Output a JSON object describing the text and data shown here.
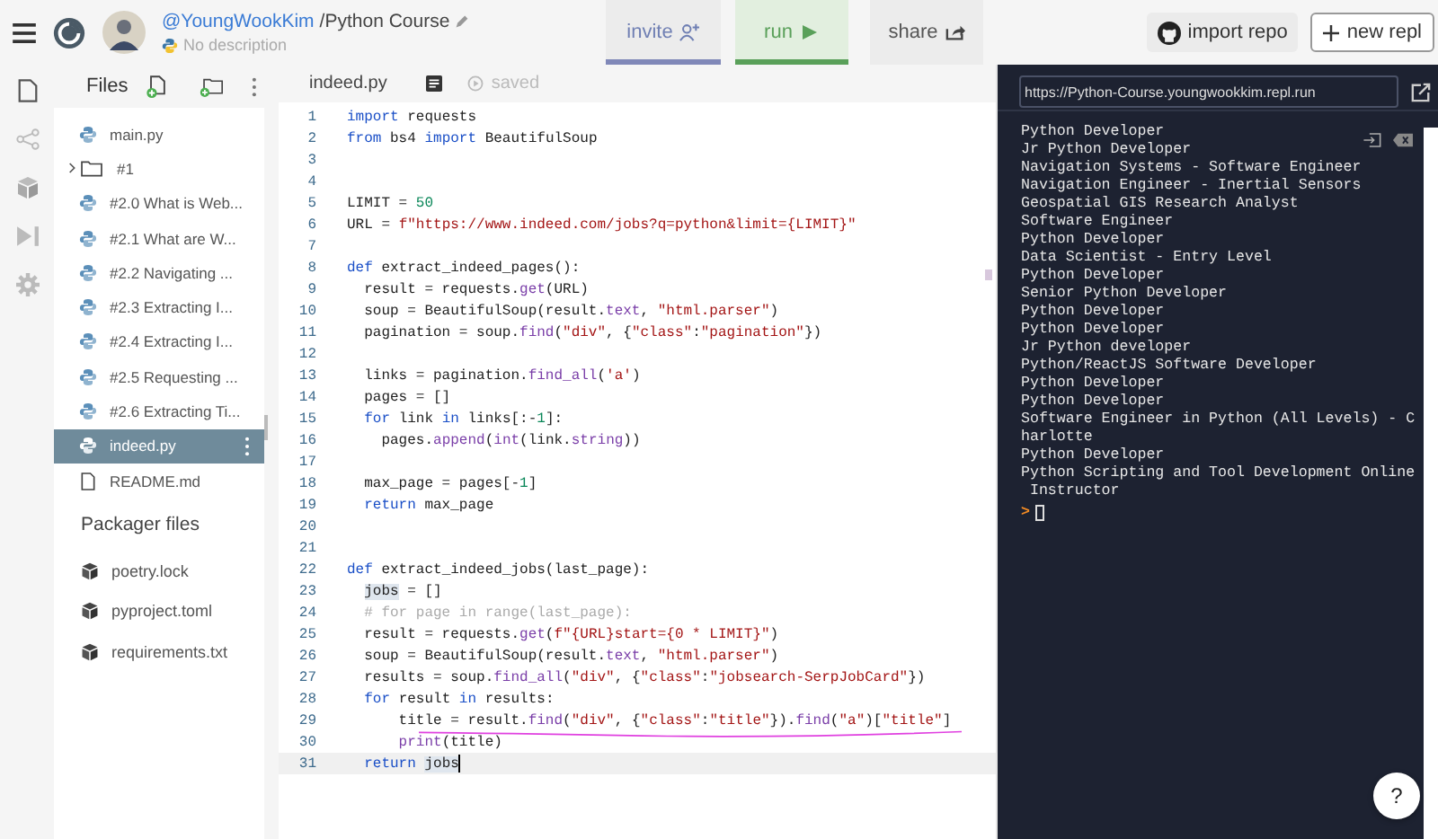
{
  "header": {
    "user": "@YoungWookKim",
    "project": "/Python Course",
    "description": "No description",
    "actions": [
      {
        "kind": "invite",
        "label": "invite",
        "selected": true
      },
      {
        "kind": "run",
        "label": "run",
        "selected": true
      },
      {
        "kind": "share",
        "label": "share",
        "selected": false
      }
    ],
    "import_label": "import repo",
    "new_label": "new repl"
  },
  "rail": [
    {
      "kind": "files",
      "selected": true
    },
    {
      "kind": "share",
      "selected": false
    },
    {
      "kind": "packages",
      "selected": false
    },
    {
      "kind": "debugger",
      "selected": false
    },
    {
      "kind": "settings",
      "selected": false
    }
  ],
  "files": {
    "title": "Files",
    "items": [
      {
        "kind": "python",
        "name": "main.py",
        "selected": false
      },
      {
        "kind": "folder",
        "name": "#1",
        "selected": false,
        "expanded": false
      },
      {
        "kind": "python",
        "name": "#2.0 What is Web...",
        "selected": false
      },
      {
        "kind": "python",
        "name": "#2.1 What are W...",
        "selected": false
      },
      {
        "kind": "python",
        "name": "#2.2 Navigating ...",
        "selected": false
      },
      {
        "kind": "python",
        "name": "#2.3 Extracting I...",
        "selected": false
      },
      {
        "kind": "python",
        "name": "#2.4 Extracting I...",
        "selected": false
      },
      {
        "kind": "python",
        "name": "#2.5 Requesting ...",
        "selected": false
      },
      {
        "kind": "python",
        "name": "#2.6 Extracting Ti...",
        "selected": false
      },
      {
        "kind": "python",
        "name": "indeed.py",
        "selected": true
      },
      {
        "kind": "file",
        "name": "README.md",
        "selected": false
      }
    ],
    "packager_title": "Packager files",
    "packager_items": [
      "poetry.lock",
      "pyproject.toml",
      "requirements.txt"
    ]
  },
  "editor": {
    "tab": "indeed.py",
    "status": "saved",
    "lines": [
      {
        "n": "1",
        "tokens": [
          {
            "kind": "k",
            "text": "import"
          },
          {
            "kind": "p",
            "text": " requests"
          }
        ]
      },
      {
        "n": "2",
        "tokens": [
          {
            "kind": "k",
            "text": "from"
          },
          {
            "kind": "p",
            "text": " bs4 "
          },
          {
            "kind": "k",
            "text": "import"
          },
          {
            "kind": "p",
            "text": " BeautifulSoup"
          }
        ]
      },
      {
        "n": "3"
      },
      {
        "n": "4"
      },
      {
        "n": "5",
        "tokens": [
          {
            "kind": "p",
            "text": "LIMIT = "
          },
          {
            "kind": "n",
            "text": "50"
          }
        ]
      },
      {
        "n": "6",
        "tokens": [
          {
            "kind": "p",
            "text": "URL = "
          },
          {
            "kind": "s",
            "text": "f\"https://www.indeed.com/jobs?q=python&limit={LIMIT}\""
          }
        ]
      },
      {
        "n": "7"
      },
      {
        "n": "8",
        "tokens": [
          {
            "kind": "k",
            "text": "def"
          },
          {
            "kind": "p",
            "text": " extract_indeed_pages():"
          }
        ]
      },
      {
        "n": "9",
        "tokens": [
          {
            "kind": "p",
            "text": "  result = requests."
          },
          {
            "kind": "f",
            "text": "get"
          },
          {
            "kind": "p",
            "text": "(URL)"
          }
        ]
      },
      {
        "n": "10",
        "tokens": [
          {
            "kind": "p",
            "text": "  soup = BeautifulSoup(result."
          },
          {
            "kind": "f",
            "text": "text"
          },
          {
            "kind": "p",
            "text": ", "
          },
          {
            "kind": "s",
            "text": "\"html.parser\""
          },
          {
            "kind": "p",
            "text": ")"
          }
        ]
      },
      {
        "n": "11",
        "tokens": [
          {
            "kind": "p",
            "text": "  pagination = soup."
          },
          {
            "kind": "f",
            "text": "find"
          },
          {
            "kind": "p",
            "text": "("
          },
          {
            "kind": "s",
            "text": "\"div\""
          },
          {
            "kind": "p",
            "text": ", {"
          },
          {
            "kind": "s",
            "text": "\"class\""
          },
          {
            "kind": "p",
            "text": ":"
          },
          {
            "kind": "s",
            "text": "\"pagination\""
          },
          {
            "kind": "p",
            "text": "})"
          }
        ]
      },
      {
        "n": "12"
      },
      {
        "n": "13",
        "tokens": [
          {
            "kind": "p",
            "text": "  links = pagination."
          },
          {
            "kind": "f",
            "text": "find_all"
          },
          {
            "kind": "p",
            "text": "("
          },
          {
            "kind": "s",
            "text": "'a'"
          },
          {
            "kind": "p",
            "text": ")"
          }
        ]
      },
      {
        "n": "14",
        "tokens": [
          {
            "kind": "p",
            "text": "  pages = []"
          }
        ]
      },
      {
        "n": "15",
        "tokens": [
          {
            "kind": "k",
            "text": "  for"
          },
          {
            "kind": "p",
            "text": " link "
          },
          {
            "kind": "k",
            "text": "in"
          },
          {
            "kind": "p",
            "text": " links[:-"
          },
          {
            "kind": "n",
            "text": "1"
          },
          {
            "kind": "p",
            "text": "]:"
          }
        ]
      },
      {
        "n": "16",
        "tokens": [
          {
            "kind": "p",
            "text": "    pages."
          },
          {
            "kind": "f",
            "text": "append"
          },
          {
            "kind": "p",
            "text": "("
          },
          {
            "kind": "f",
            "text": "int"
          },
          {
            "kind": "p",
            "text": "(link."
          },
          {
            "kind": "f",
            "text": "string"
          },
          {
            "kind": "p",
            "text": "))"
          }
        ]
      },
      {
        "n": "17"
      },
      {
        "n": "18",
        "tokens": [
          {
            "kind": "p",
            "text": "  max_page = pages[-"
          },
          {
            "kind": "n",
            "text": "1"
          },
          {
            "kind": "p",
            "text": "]"
          }
        ]
      },
      {
        "n": "19",
        "tokens": [
          {
            "kind": "k",
            "text": "  return"
          },
          {
            "kind": "p",
            "text": " max_page"
          }
        ]
      },
      {
        "n": "20"
      },
      {
        "n": "21"
      },
      {
        "n": "22",
        "tokens": [
          {
            "kind": "k",
            "text": "def"
          },
          {
            "kind": "p",
            "text": " extract_indeed_jobs(last_page):"
          }
        ]
      },
      {
        "n": "23",
        "tokens": [
          {
            "kind": "h",
            "text": "jobs"
          },
          {
            "kind": "p",
            "text": " = []"
          }
        ]
      },
      {
        "n": "24",
        "tokens": [
          {
            "kind": "c",
            "text": "  # for page in range(last_page):"
          }
        ]
      },
      {
        "n": "25",
        "tokens": [
          {
            "kind": "p",
            "text": "  result = requests."
          },
          {
            "kind": "f",
            "text": "get"
          },
          {
            "kind": "p",
            "text": "("
          },
          {
            "kind": "s",
            "text": "f\"{URL}start={0 * LIMIT}\""
          },
          {
            "kind": "p",
            "text": ")"
          }
        ]
      },
      {
        "n": "26",
        "tokens": [
          {
            "kind": "p",
            "text": "  soup = BeautifulSoup(result."
          },
          {
            "kind": "f",
            "text": "text"
          },
          {
            "kind": "p",
            "text": ", "
          },
          {
            "kind": "s",
            "text": "\"html.parser\""
          },
          {
            "kind": "p",
            "text": ")"
          }
        ]
      },
      {
        "n": "27",
        "tokens": [
          {
            "kind": "p",
            "text": "  results = soup."
          },
          {
            "kind": "f",
            "text": "find_all"
          },
          {
            "kind": "p",
            "text": "("
          },
          {
            "kind": "s",
            "text": "\"div\""
          },
          {
            "kind": "p",
            "text": ", {"
          },
          {
            "kind": "s",
            "text": "\"class\""
          },
          {
            "kind": "p",
            "text": ":"
          },
          {
            "kind": "s",
            "text": "\"jobsearch-SerpJobCard\""
          },
          {
            "kind": "p",
            "text": "})"
          }
        ]
      },
      {
        "n": "28",
        "tokens": [
          {
            "kind": "k",
            "text": "  for"
          },
          {
            "kind": "p",
            "text": " result "
          },
          {
            "kind": "k",
            "text": "in"
          },
          {
            "kind": "p",
            "text": " results:"
          }
        ]
      },
      {
        "n": "29",
        "squiggle": true,
        "tokens": [
          {
            "kind": "p",
            "text": "      title = result."
          },
          {
            "kind": "f",
            "text": "find"
          },
          {
            "kind": "p",
            "text": "("
          },
          {
            "kind": "s",
            "text": "\"div\""
          },
          {
            "kind": "p",
            "text": ", {"
          },
          {
            "kind": "s",
            "text": "\"class\""
          },
          {
            "kind": "p",
            "text": ":"
          },
          {
            "kind": "s",
            "text": "\"title\""
          },
          {
            "kind": "p",
            "text": "})."
          },
          {
            "kind": "f",
            "text": "find"
          },
          {
            "kind": "p",
            "text": "("
          },
          {
            "kind": "s",
            "text": "\"a\""
          },
          {
            "kind": "p",
            "text": ")["
          },
          {
            "kind": "s",
            "text": "\"title\""
          },
          {
            "kind": "p",
            "text": "]"
          }
        ]
      },
      {
        "n": "30",
        "tokens": [
          {
            "kind": "f",
            "text": "      print"
          },
          {
            "kind": "p",
            "text": "(title)"
          }
        ]
      },
      {
        "n": "31",
        "current": true,
        "tokens": [
          {
            "kind": "k",
            "text": "  return "
          },
          {
            "kind": "h",
            "text": "jobs"
          }
        ]
      }
    ]
  },
  "console": {
    "url": "https://Python-Course.youngwookkim.repl.run",
    "output": [
      "Python Developer",
      "Jr Python Developer",
      "Navigation Systems - Software Engineer",
      "Navigation Engineer - Inertial Sensors",
      "Geospatial GIS Research Analyst",
      "Software Engineer",
      "Python Developer",
      "Data Scientist - Entry Level",
      "Python Developer",
      "Senior Python Developer",
      "Python Developer",
      "Python Developer",
      "Jr Python developer",
      "Python/ReactJS Software Developer",
      "Python Developer",
      "Python Developer",
      "Software Engineer in Python (All Levels) - C",
      "harlotte",
      "Python Developer",
      "Python Scripting and Tool Development Online",
      " Instructor"
    ],
    "prompt": ">"
  },
  "help": "?"
}
